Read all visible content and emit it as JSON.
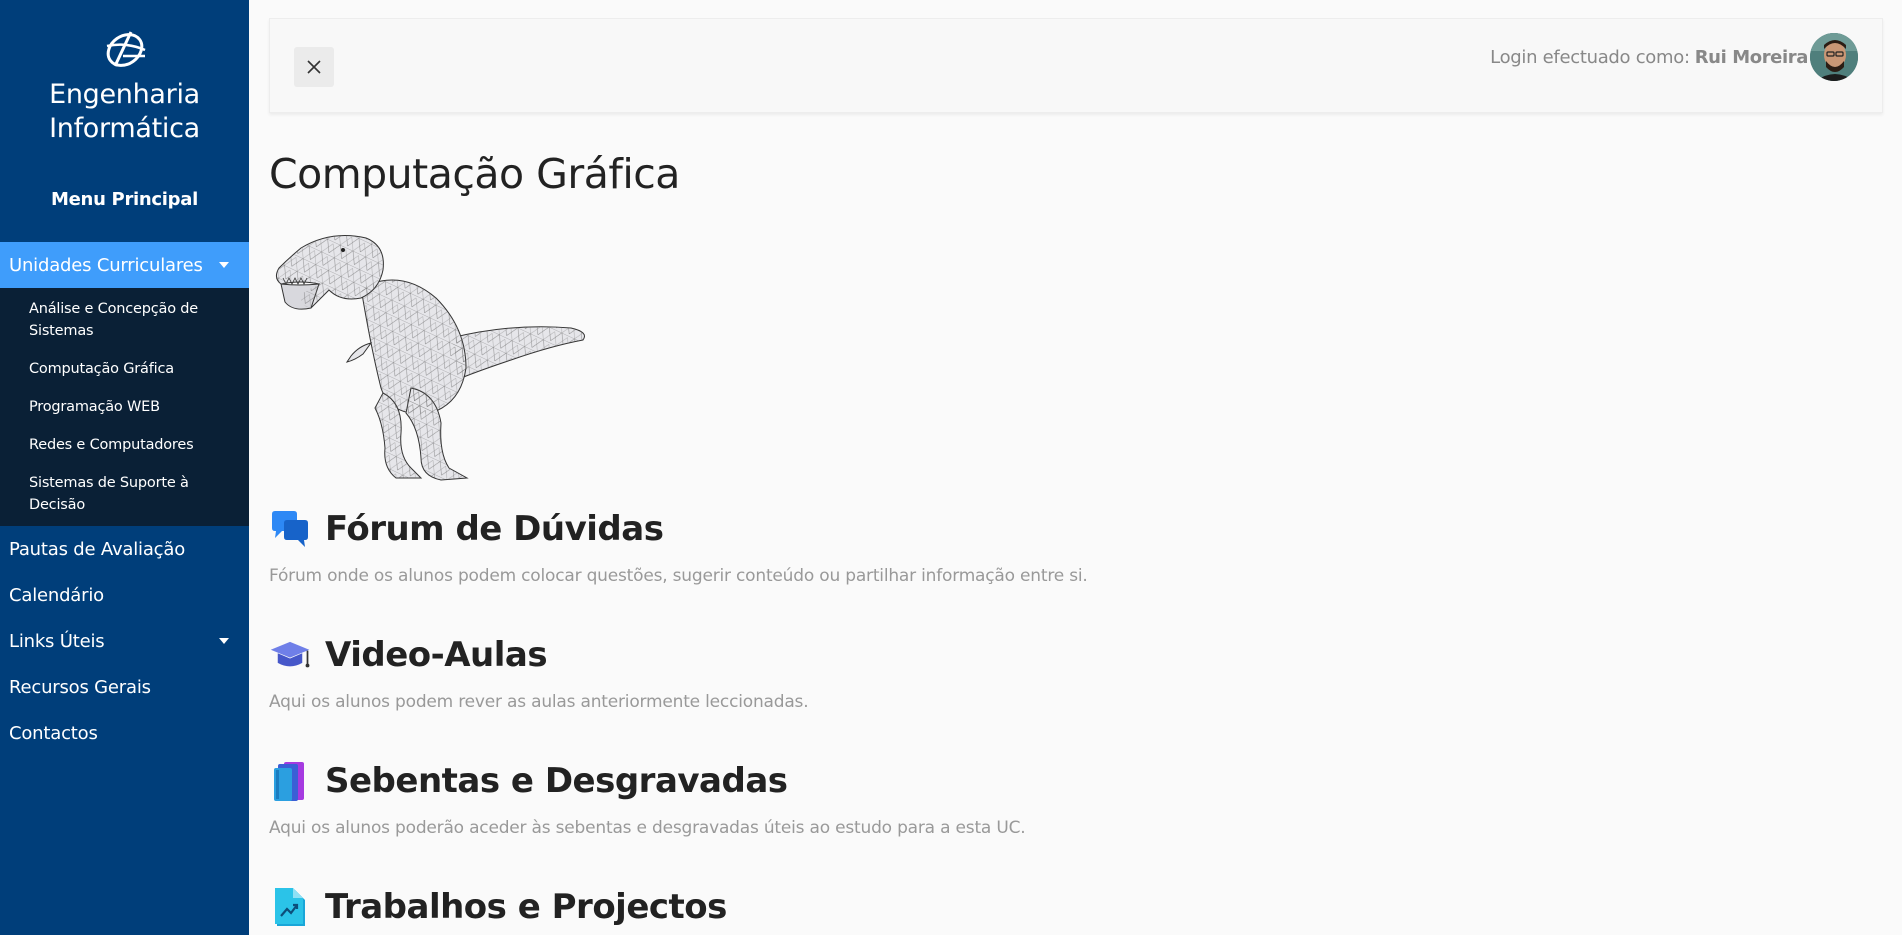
{
  "sidebar": {
    "brand": {
      "line1": "Engenharia",
      "line2": "Informática"
    },
    "menu_title": "Menu Principal",
    "active_item": "Unidades Curriculares",
    "submenu": [
      "Análise e Concepção de Sistemas",
      "Computação Gráfica",
      "Programação WEB",
      "Redes e Computadores",
      "Sistemas de Suporte à Decisão"
    ],
    "items": [
      "Pautas de Avaliação",
      "Calendário",
      "Links Úteis",
      "Recursos Gerais",
      "Contactos"
    ]
  },
  "topbar": {
    "login_label": "Login efectuado como:",
    "user_name": "Rui Moreira"
  },
  "main": {
    "title": "Computação Gráfica",
    "sections": [
      {
        "title": "Fórum de Dúvidas",
        "description": "Fórum onde os alunos podem colocar questões, sugerir conteúdo ou partilhar informação entre si.",
        "icon": "chat-icon"
      },
      {
        "title": "Video-Aulas",
        "description": "Aqui os alunos podem rever as aulas anteriormente leccionadas.",
        "icon": "graduation-cap-icon"
      },
      {
        "title": "Sebentas e Desgravadas",
        "description": "Aqui os alunos poderão aceder às sebentas e desgravadas úteis ao estudo para a esta UC.",
        "icon": "books-icon"
      },
      {
        "title": "Trabalhos e Projectos",
        "description": "",
        "icon": "document-chart-icon"
      }
    ]
  },
  "colors": {
    "sidebar_bg": "#003e7a",
    "active_item_bg": "#3f9dfb",
    "submenu_bg": "#0a2036",
    "page_bg": "#fafafa"
  }
}
